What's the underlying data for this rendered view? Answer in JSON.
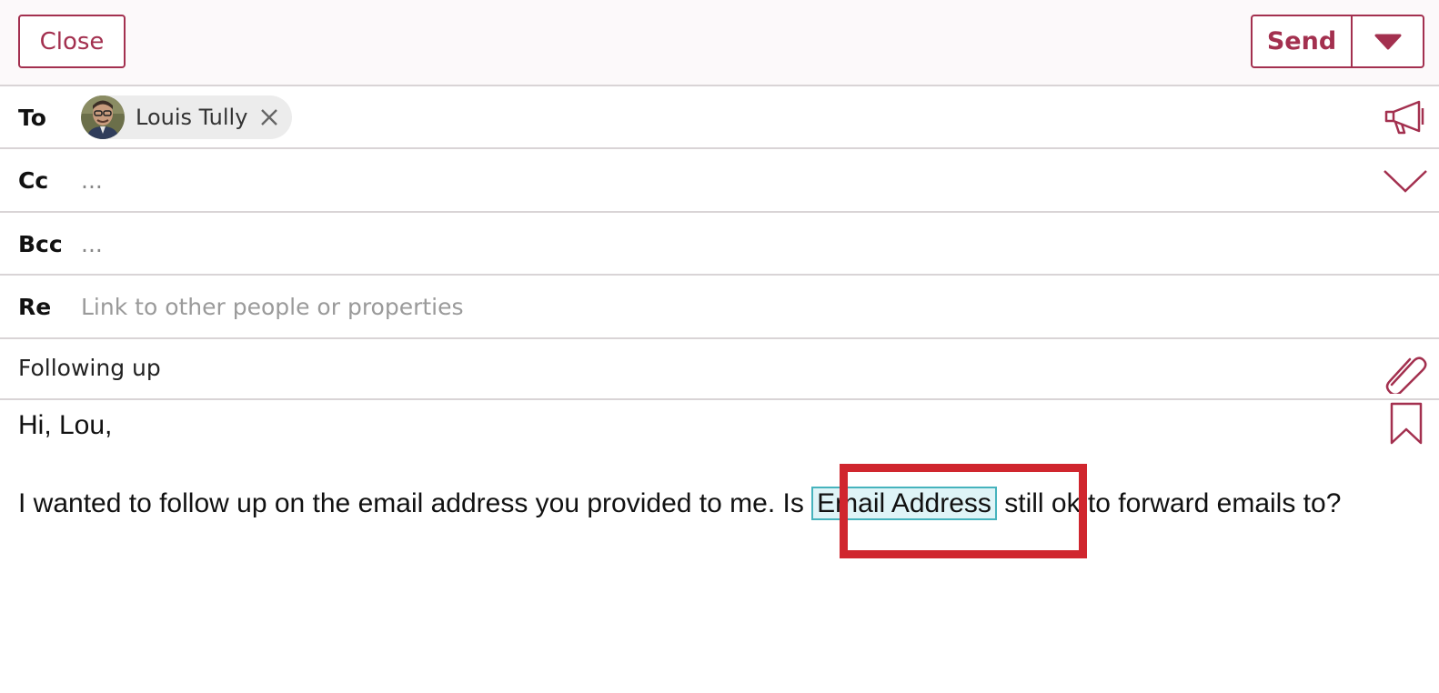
{
  "toolbar": {
    "close_label": "Close",
    "send_label": "Send"
  },
  "fields": {
    "to": {
      "label": "To",
      "recipient": "Louis Tully"
    },
    "cc": {
      "label": "Cc",
      "value": "..."
    },
    "bcc": {
      "label": "Bcc",
      "value": "..."
    },
    "re": {
      "label": "Re",
      "placeholder": "Link to other people or properties"
    }
  },
  "subject": "Following up",
  "body": {
    "greeting": "Hi, Lou,",
    "message_before": "I wanted to follow up on the email address you provided to me. Is ",
    "token": "Email Address",
    "message_after": " still ok to forward emails to?"
  },
  "icons": {
    "send_menu": "caret-down-icon",
    "to_action": "megaphone-icon",
    "cc_action": "chevron-down-icon",
    "attach": "paperclip-icon",
    "template": "bookmark-icon"
  },
  "colors": {
    "accent": "#a3304f",
    "token_bg": "#dff4f7",
    "token_border": "#46b3bd",
    "highlight": "#d0262e"
  }
}
